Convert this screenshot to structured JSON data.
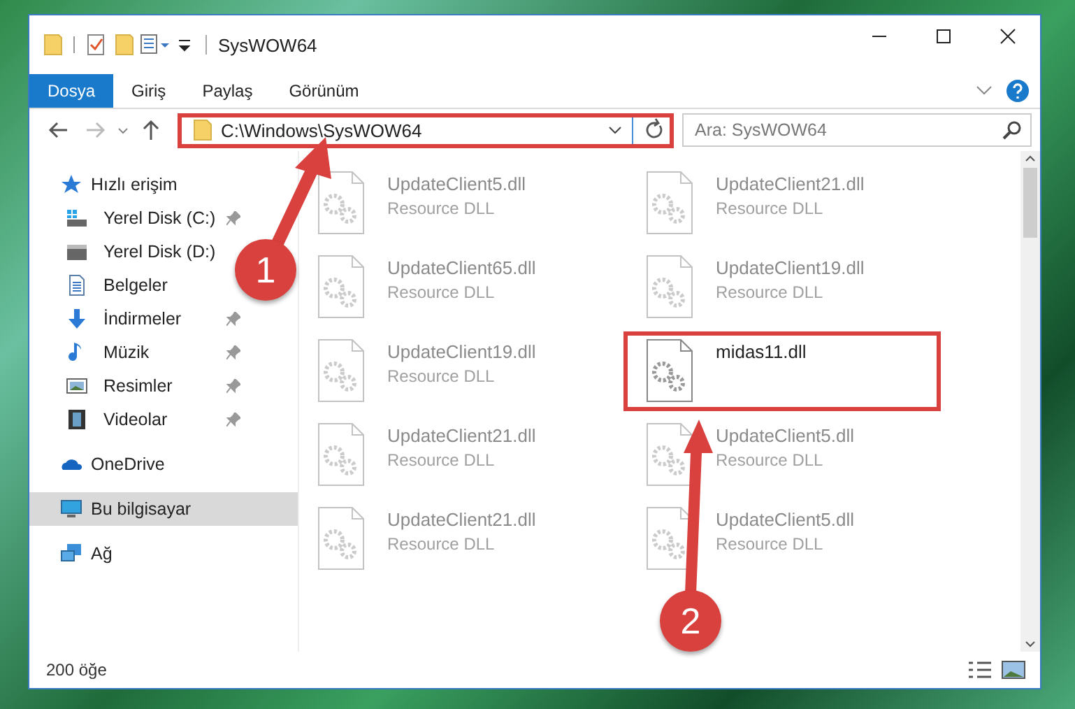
{
  "window": {
    "title": "SysWOW64"
  },
  "ribbon_tabs": [
    {
      "label": "Dosya",
      "kind": "file"
    },
    {
      "label": "Giriş",
      "kind": "tab"
    },
    {
      "label": "Paylaş",
      "kind": "tab"
    },
    {
      "label": "Görünüm",
      "kind": "tab"
    }
  ],
  "address": {
    "path": "C:\\Windows\\SysWOW64",
    "highlighted": true
  },
  "search": {
    "placeholder": "Ara: SysWOW64"
  },
  "navigation": [
    {
      "label": "Hızlı erişim",
      "kind": "star",
      "selected": false,
      "children": [
        {
          "label": "Yerel Disk (C:)",
          "kind": "drive-windows",
          "pinned": true,
          "selected": false
        },
        {
          "label": "Yerel Disk (D:)",
          "kind": "drive",
          "pinned": false,
          "selected": false
        },
        {
          "label": "Belgeler",
          "kind": "document",
          "pinned": false,
          "selected": false
        },
        {
          "label": "İndirmeler",
          "kind": "download",
          "pinned": true,
          "selected": false
        },
        {
          "label": "Müzik",
          "kind": "music",
          "pinned": true,
          "selected": false
        },
        {
          "label": "Resimler",
          "kind": "picture",
          "pinned": true,
          "selected": false
        },
        {
          "label": "Videolar",
          "kind": "video",
          "pinned": true,
          "selected": false
        }
      ]
    },
    {
      "label": "OneDrive",
      "kind": "cloud",
      "selected": false
    },
    {
      "label": "Bu bilgisayar",
      "kind": "computer",
      "selected": true
    },
    {
      "label": "Ağ",
      "kind": "network",
      "selected": false
    }
  ],
  "files": [
    {
      "name": "UpdateClient5.dll",
      "type": "Resource DLL",
      "blurred": true,
      "highlighted": false
    },
    {
      "name": "UpdateClient21.dll",
      "type": "Resource DLL",
      "blurred": true,
      "highlighted": false
    },
    {
      "name": "UpdateClient65.dll",
      "type": "Resource DLL",
      "blurred": true,
      "highlighted": false
    },
    {
      "name": "UpdateClient19.dll",
      "type": "Resource DLL",
      "blurred": true,
      "highlighted": false
    },
    {
      "name": "UpdateClient19.dll",
      "type": "Resource DLL",
      "blurred": true,
      "highlighted": false
    },
    {
      "name": "midas11.dll",
      "blurred": false,
      "highlighted": true
    },
    {
      "name": "UpdateClient21.dll",
      "type": "Resource DLL",
      "blurred": true,
      "highlighted": false
    },
    {
      "name": "UpdateClient5.dll",
      "type": "Resource DLL",
      "blurred": true,
      "highlighted": false
    },
    {
      "name": "UpdateClient21.dll",
      "type": "Resource DLL",
      "blurred": true,
      "highlighted": false
    },
    {
      "name": "UpdateClient5.dll",
      "type": "Resource DLL",
      "blurred": true,
      "highlighted": false
    }
  ],
  "status_bar": {
    "item_count": "200 öğe"
  },
  "annotations": [
    {
      "number": "1"
    },
    {
      "number": "2"
    }
  ]
}
